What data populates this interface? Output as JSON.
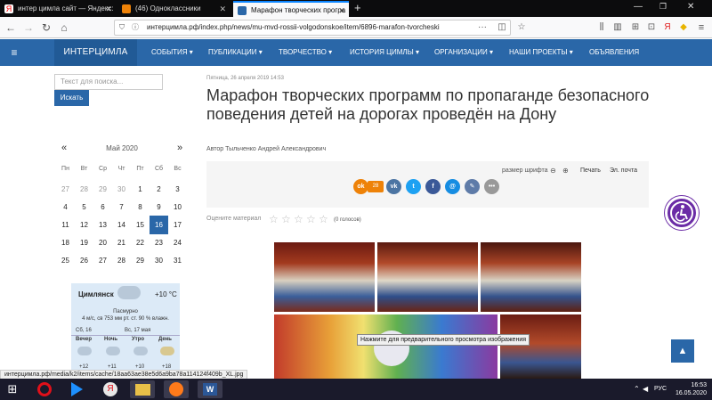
{
  "tabs": [
    {
      "title": "интер цимла сайт — Яндекс:",
      "active": false
    },
    {
      "title": "(46) Одноклассники",
      "active": false
    },
    {
      "title": "Марафон творческих програ",
      "active": true
    }
  ],
  "new_tab": "+",
  "url": "интерцимла.рф/index.php/news/mu-mvd-rossii-volgodonskoe/item/6896-marafon-tvorcheski",
  "site": {
    "logo": "ИНТЕРЦИМЛА",
    "menu": [
      "СОБЫТИЯ",
      "ПУБЛИКАЦИИ",
      "ТВОРЧЕСТВО",
      "ИСТОРИЯ ЦИМЛЫ",
      "ОРГАНИЗАЦИИ",
      "НАШИ ПРОЕКТЫ",
      "ОБЪЯВЛЕНИЯ"
    ]
  },
  "search": {
    "placeholder": "Текст для поиска...",
    "button": "Искать"
  },
  "calendar": {
    "prev": "«",
    "next": "»",
    "title": "Май 2020",
    "weekdays": [
      "Пн",
      "Вт",
      "Ср",
      "Чт",
      "Пт",
      "Сб",
      "Вс"
    ],
    "weeks": [
      [
        "27",
        "28",
        "29",
        "30",
        "1",
        "2",
        "3"
      ],
      [
        "4",
        "5",
        "6",
        "7",
        "8",
        "9",
        "10"
      ],
      [
        "11",
        "12",
        "13",
        "14",
        "15",
        "16",
        "17"
      ],
      [
        "18",
        "19",
        "20",
        "21",
        "22",
        "23",
        "24"
      ],
      [
        "25",
        "26",
        "27",
        "28",
        "29",
        "30",
        "31"
      ]
    ],
    "today": "16"
  },
  "weather": {
    "city": "Цимлянск",
    "temp": "+10 °C",
    "condition": "Пасмурно",
    "details": "4 м/с, св   753 мм рт. ст.   90 % влажн.",
    "day1": "Сб, 16",
    "day2": "Вс, 17 мая",
    "periods": [
      "Вечер",
      "Ночь",
      "Утро",
      "День"
    ],
    "temps": [
      "+12",
      "+11",
      "+10",
      "+18"
    ]
  },
  "article": {
    "date": "Пятница, 26 апреля 2019 14:53",
    "title": "Марафон творческих программ по пропаганде безопасного поведения детей на дорогах проведён на Дону",
    "author_label": "Автор",
    "author": "Тыльченко Андрей Александрович",
    "font_size_label": "размер шрифта",
    "print": "Печать",
    "email": "Эл. почта",
    "ok_count": "28",
    "rate_label": "Оцените материал",
    "votes": "(0 голосов)"
  },
  "tooltip": "Нажмите для предварительного просмотра изображения",
  "status_url": "интерцимла.рф/media/k2/items/cache/18aa63ae38e5d6a9ba78a114124f409b_XL.jpg",
  "taskbar": {
    "lang": "РУС",
    "time": "16:53",
    "date": "16.05.2020"
  },
  "colors": {
    "brand": "#2a67a8",
    "accessibility": "#6b2ca6"
  }
}
